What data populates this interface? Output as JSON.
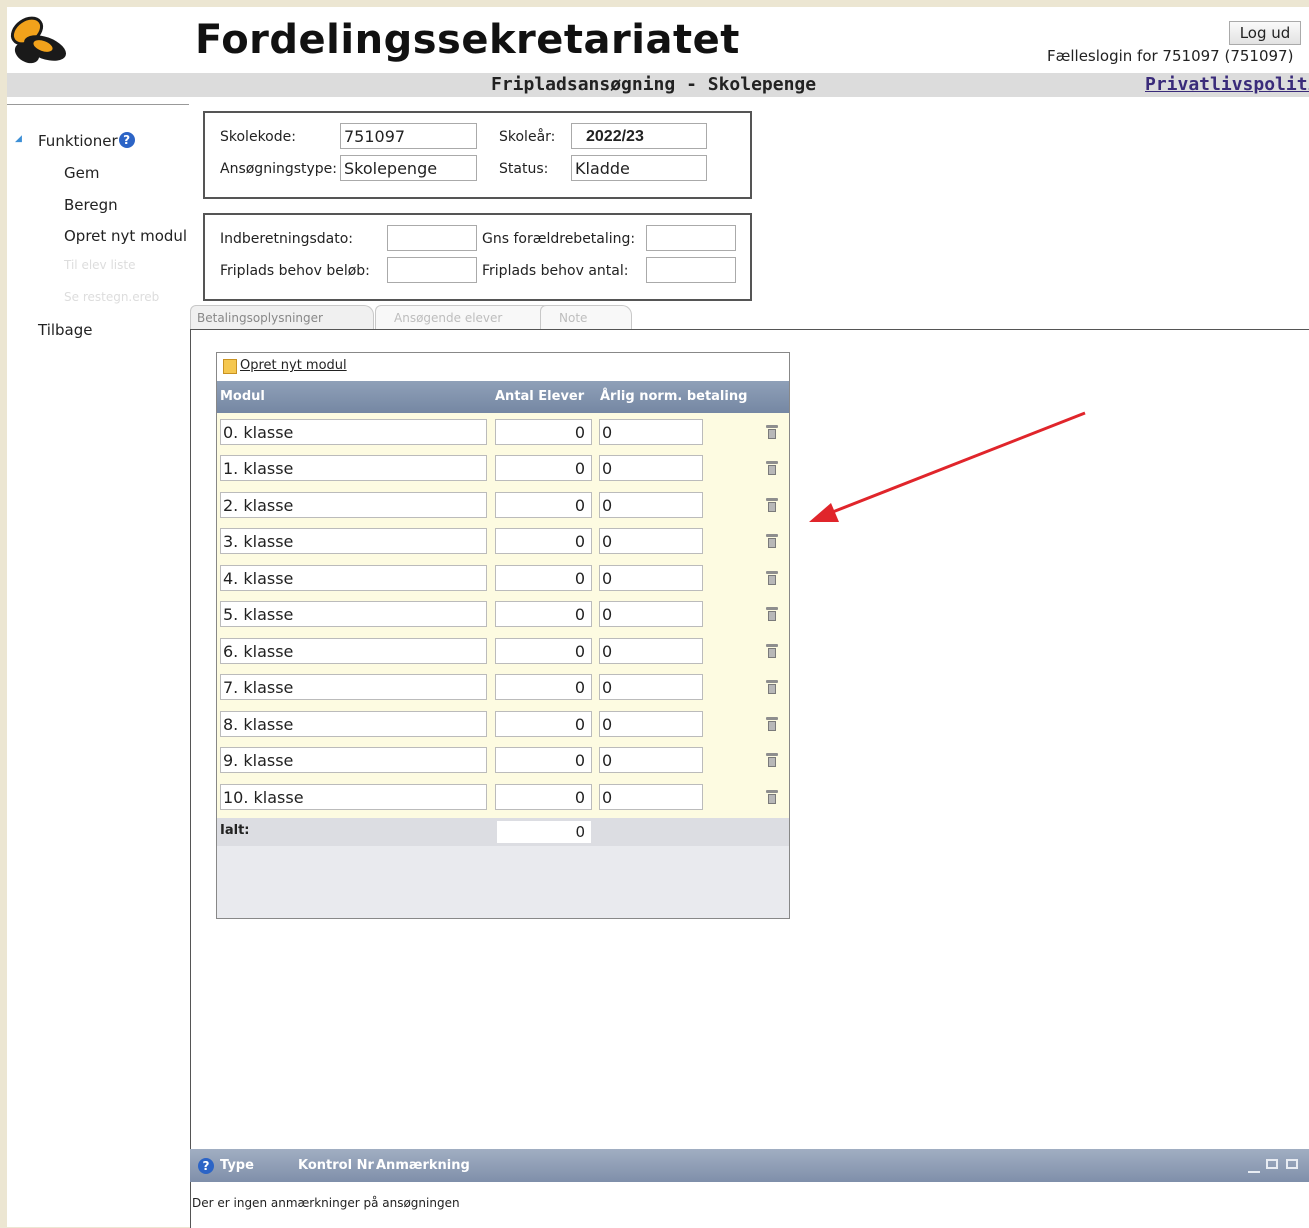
{
  "header": {
    "app_title": "Fordelingssekretariatet",
    "subtitle": "Fripladsansøgning - Skolepenge",
    "logout_label": "Log ud",
    "login_info": "Fælleslogin for 751097 (751097)",
    "privacy_link": "Privatlivspolitik"
  },
  "sidebar": {
    "section_label": "Funktioner",
    "help_glyph": "?",
    "items": [
      {
        "label": "Gem",
        "enabled": true
      },
      {
        "label": "Beregn",
        "enabled": true
      },
      {
        "label": "Opret nyt modul",
        "enabled": true
      },
      {
        "label": "Til elev liste",
        "enabled": false
      },
      {
        "label": "Se restegn.ereb",
        "enabled": false
      }
    ],
    "back_label": "Tilbage"
  },
  "info": {
    "skolekode_label": "Skolekode:",
    "skolekode_value": "751097",
    "skoleaar_label": "Skoleår:",
    "skoleaar_value": "2022/23",
    "ansoegningstype_label": "Ansøgningstype:",
    "ansoegningstype_value": "Skolepenge",
    "status_label": "Status:",
    "status_value": "Kladde"
  },
  "report": {
    "indberetningsdato_label": "Indberetningsdato:",
    "indberetningsdato_value": "",
    "gns_label": "Gns forældrebetaling:",
    "gns_value": "",
    "friplads_beloeb_label": "Friplads behov beløb:",
    "friplads_beloeb_value": "",
    "friplads_antal_label": "Friplads behov antal:",
    "friplads_antal_value": ""
  },
  "tabs": [
    {
      "label": "Betalingsoplysninger",
      "active": true
    },
    {
      "label": "Ansøgende elever",
      "active": false
    },
    {
      "label": "Note",
      "active": false
    }
  ],
  "grid": {
    "new_module_link": "Opret nyt modul",
    "columns": {
      "modul": "Modul",
      "antal": "Antal Elever",
      "betaling": "Årlig norm. betaling"
    },
    "rows": [
      {
        "modul": "0. klasse",
        "antal": "0",
        "betaling": "0"
      },
      {
        "modul": "1. klasse",
        "antal": "0",
        "betaling": "0"
      },
      {
        "modul": "2. klasse",
        "antal": "0",
        "betaling": "0"
      },
      {
        "modul": "3. klasse",
        "antal": "0",
        "betaling": "0"
      },
      {
        "modul": "4. klasse",
        "antal": "0",
        "betaling": "0"
      },
      {
        "modul": "5. klasse",
        "antal": "0",
        "betaling": "0"
      },
      {
        "modul": "6. klasse",
        "antal": "0",
        "betaling": "0"
      },
      {
        "modul": "7. klasse",
        "antal": "0",
        "betaling": "0"
      },
      {
        "modul": "8. klasse",
        "antal": "0",
        "betaling": "0"
      },
      {
        "modul": "9. klasse",
        "antal": "0",
        "betaling": "0"
      },
      {
        "modul": "10. klasse",
        "antal": "0",
        "betaling": "0"
      }
    ],
    "total_label": "Ialt:",
    "total_value": "0"
  },
  "notes": {
    "help_glyph": "?",
    "col_type": "Type",
    "col_kontrol": "Kontrol Nr",
    "col_anmaerkning": "Anmærkning",
    "empty_message": "Der er ingen anmærkninger på ansøgningen"
  },
  "colors": {
    "accent_blue": "#2c64c6",
    "annotation_arrow": "#e0252b",
    "grid_body": "#fdfbe1",
    "header_bar": "#7587a3"
  }
}
